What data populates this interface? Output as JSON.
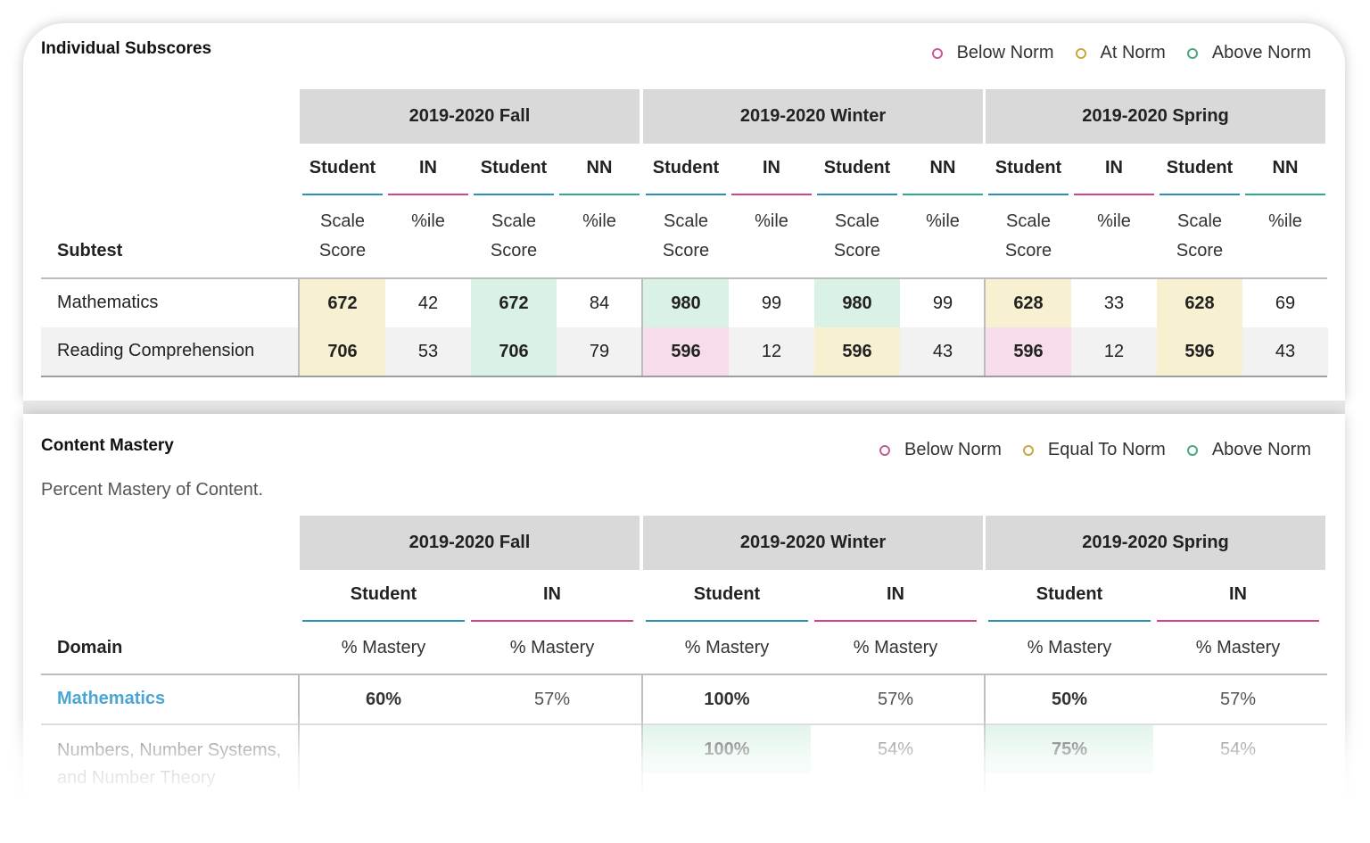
{
  "colors": {
    "student_line": "#2e8fb6",
    "in_line": "#d2458c",
    "nn_line": "#2eaa8e",
    "below_norm_fill": "#f7dcec",
    "at_norm_fill": "#f7f0d1",
    "above_norm_fill": "#d9f2e5",
    "link": "#4ba6d3",
    "header_bg": "#d9d9d9"
  },
  "subscores": {
    "title": "Individual Subscores",
    "legend": [
      {
        "label": "Below Norm",
        "color": "#c85a9a"
      },
      {
        "label": "At Norm",
        "color": "#c9a640"
      },
      {
        "label": "Above Norm",
        "color": "#4aa77e"
      }
    ],
    "periods": [
      "2019-2020 Fall",
      "2019-2020 Winter",
      "2019-2020 Spring"
    ],
    "col_labels": [
      "Student",
      "IN",
      "Student",
      "NN"
    ],
    "metric_score": [
      "Scale",
      "Score"
    ],
    "metric_pct": "%ile",
    "subtest_label": "Subtest",
    "rows": [
      {
        "name": "Mathematics",
        "cells": [
          {
            "v": "672",
            "fill": "at"
          },
          {
            "v": "42"
          },
          {
            "v": "672",
            "fill": "above"
          },
          {
            "v": "84"
          },
          {
            "v": "980",
            "fill": "above"
          },
          {
            "v": "99"
          },
          {
            "v": "980",
            "fill": "above"
          },
          {
            "v": "99"
          },
          {
            "v": "628",
            "fill": "at"
          },
          {
            "v": "33"
          },
          {
            "v": "628",
            "fill": "at"
          },
          {
            "v": "69"
          }
        ]
      },
      {
        "name": "Reading Comprehension",
        "cells": [
          {
            "v": "706",
            "fill": "at"
          },
          {
            "v": "53"
          },
          {
            "v": "706",
            "fill": "above"
          },
          {
            "v": "79"
          },
          {
            "v": "596",
            "fill": "below"
          },
          {
            "v": "12"
          },
          {
            "v": "596",
            "fill": "at"
          },
          {
            "v": "43"
          },
          {
            "v": "596",
            "fill": "below"
          },
          {
            "v": "12"
          },
          {
            "v": "596",
            "fill": "at"
          },
          {
            "v": "43"
          }
        ]
      }
    ]
  },
  "mastery": {
    "title": "Content Mastery",
    "subtitle": "Percent Mastery of Content.",
    "legend": [
      {
        "label": "Below Norm",
        "color": "#c85a9a"
      },
      {
        "label": "Equal To Norm",
        "color": "#c9a640"
      },
      {
        "label": "Above Norm",
        "color": "#4aa77e"
      }
    ],
    "periods": [
      "2019-2020 Fall",
      "2019-2020 Winter",
      "2019-2020 Spring"
    ],
    "col_labels": [
      "Student",
      "IN"
    ],
    "metric": "% Mastery",
    "domain_label": "Domain",
    "rows": [
      {
        "name": "Mathematics",
        "link": true,
        "cells": [
          "60%",
          "57%",
          "100%",
          "57%",
          "50%",
          "57%"
        ]
      },
      {
        "name_lines": [
          "Numbers, Number Systems,",
          "and Number Theory"
        ],
        "link": false,
        "cells": [
          "",
          "",
          "100%",
          "54%",
          "75%",
          "54%"
        ]
      }
    ]
  }
}
